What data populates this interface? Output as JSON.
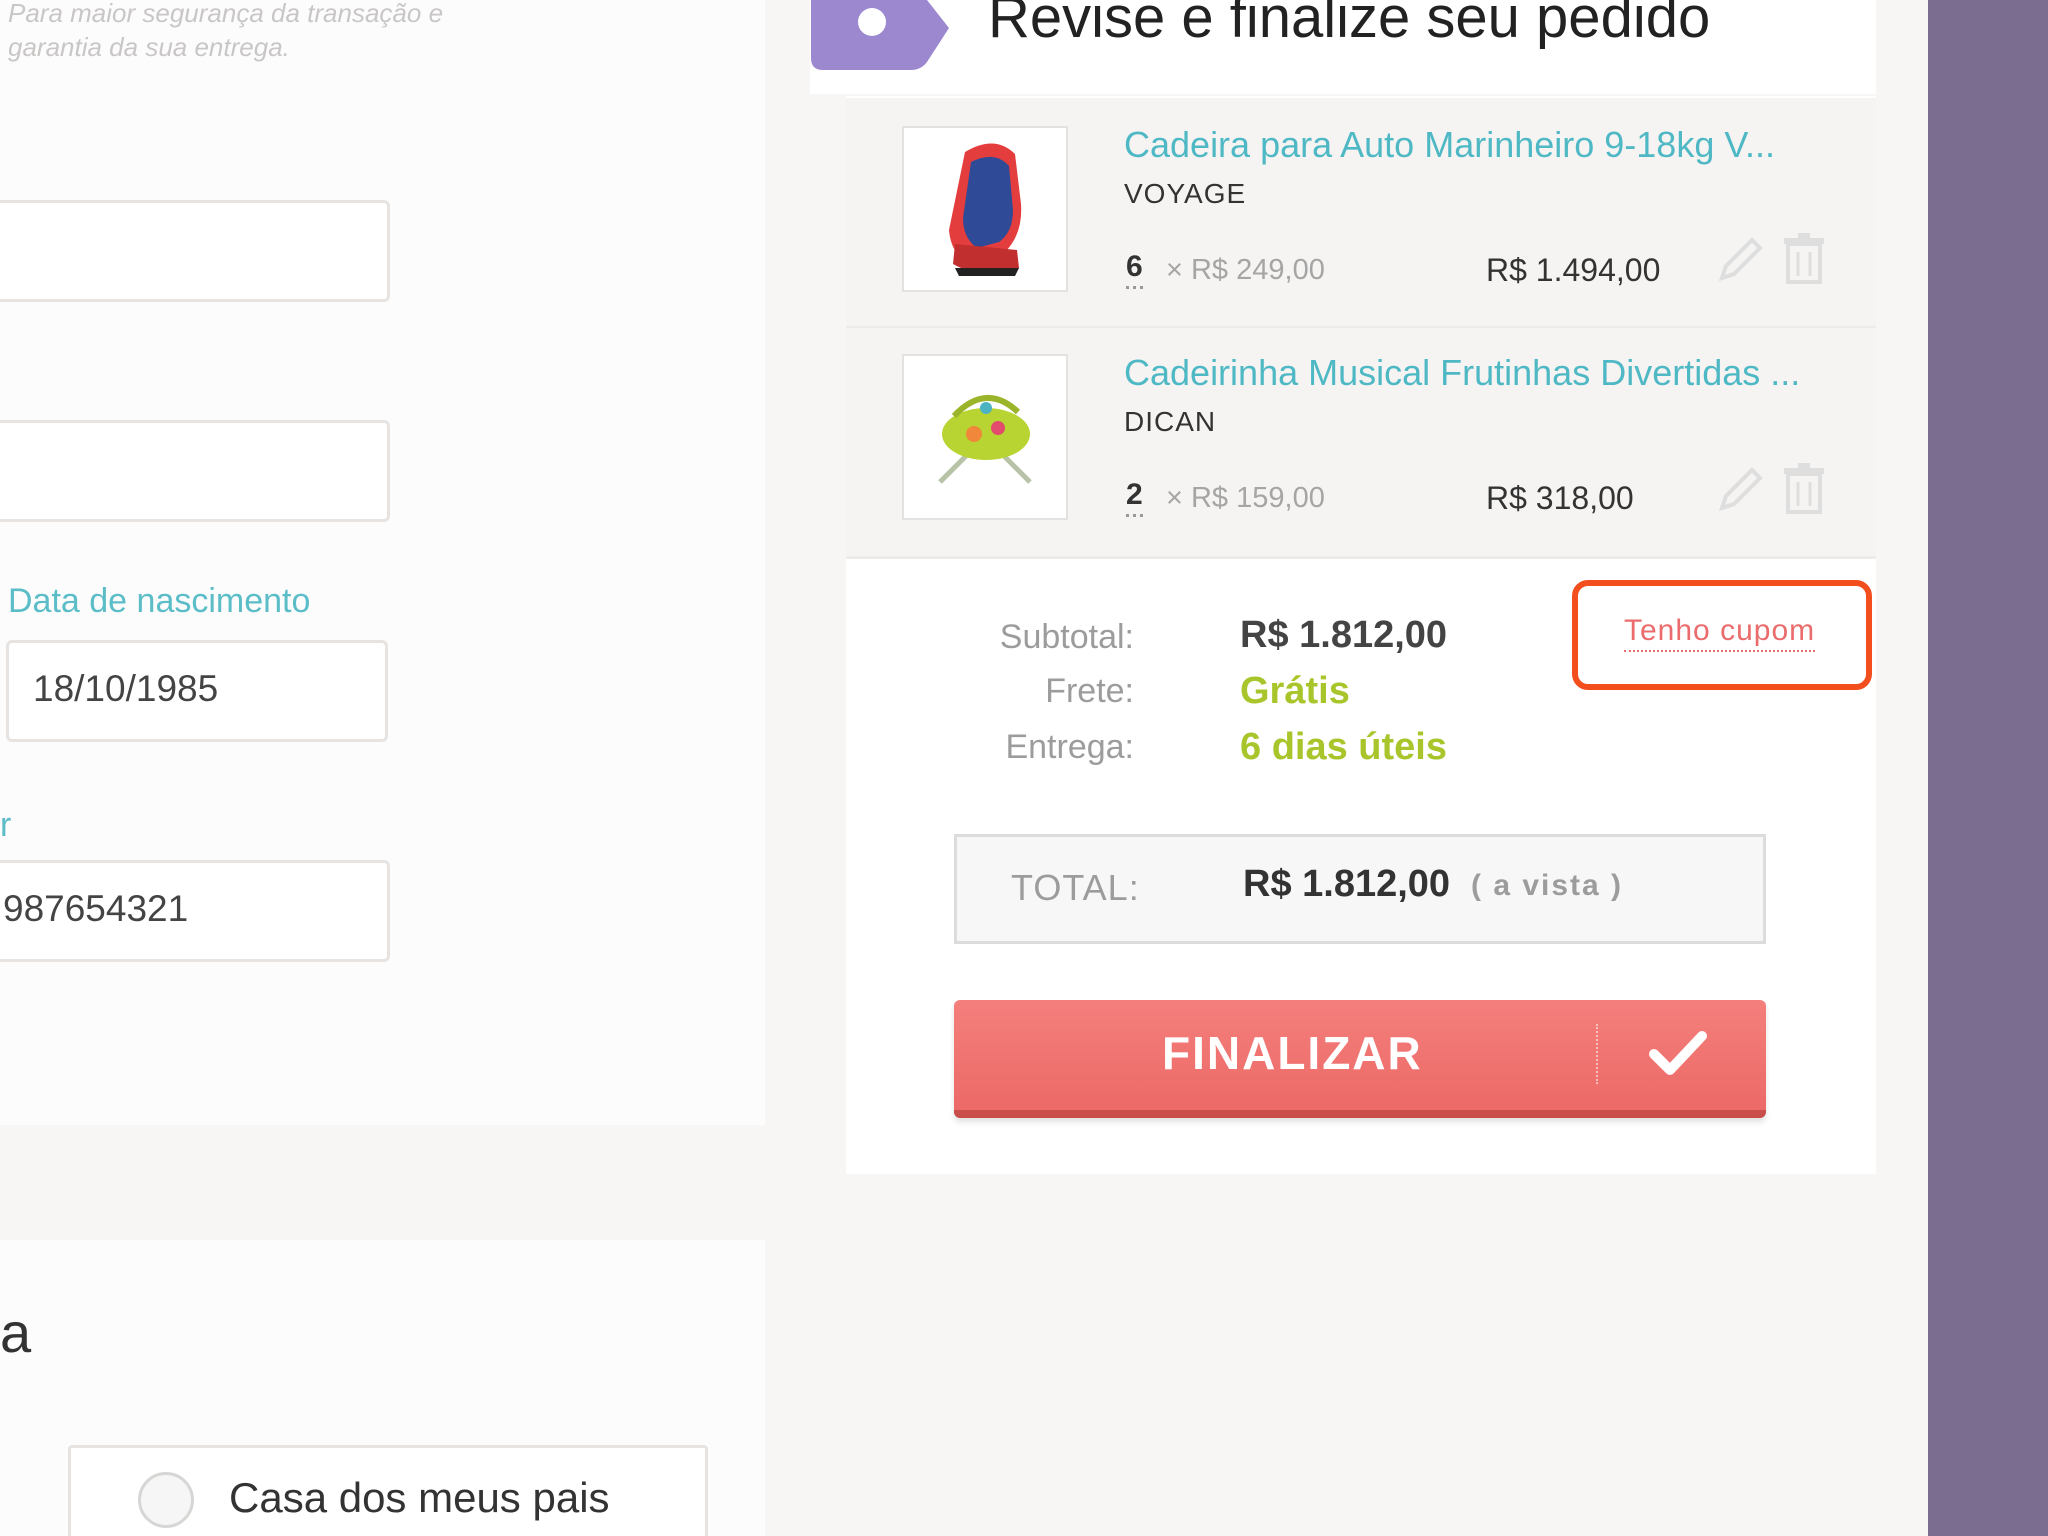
{
  "form": {
    "hint": "Para maior segurança da transação e garantia da sua entrega.",
    "field1_value": "",
    "field2_value": "",
    "birthdate_label": "Data de nascimento",
    "birthdate_value": "18/10/1985",
    "phone_label_partial": "r",
    "phone_value": "987654321",
    "section_letter": "a",
    "radio_option": "Casa dos meus pais"
  },
  "order": {
    "title": "Revise e finalize seu pedido",
    "items": [
      {
        "title": "Cadeira para Auto Marinheiro 9-18kg V...",
        "brand": "VOYAGE",
        "qty": "6",
        "unit_price": "× R$ 249,00",
        "line_total": "R$ 1.494,00",
        "thumb_icon": "car-seat-icon"
      },
      {
        "title": "Cadeirinha Musical Frutinhas Divertidas ...",
        "brand": "DICAN",
        "qty": "2",
        "unit_price": "× R$ 159,00",
        "line_total": "R$ 318,00",
        "thumb_icon": "baby-bouncer-icon"
      }
    ],
    "summary": {
      "subtotal_label": "Subtotal:",
      "subtotal_value": "R$ 1.812,00",
      "shipping_label": "Frete:",
      "shipping_value": "Grátis",
      "delivery_label": "Entrega:",
      "delivery_value": "6 dias úteis"
    },
    "coupon_link": "Tenho cupom",
    "total_label": "TOTAL:",
    "total_value": "R$ 1.812,00",
    "total_note": "( a vista )",
    "finalize_label": "FINALIZAR"
  },
  "colors": {
    "accent_teal": "#4fb8c5",
    "accent_green": "#a8c62c",
    "button_red": "#ee6f6c",
    "highlight_orange": "#f24e1e",
    "side_purple": "#7b6d8f",
    "badge_purple": "#9c88cf"
  }
}
